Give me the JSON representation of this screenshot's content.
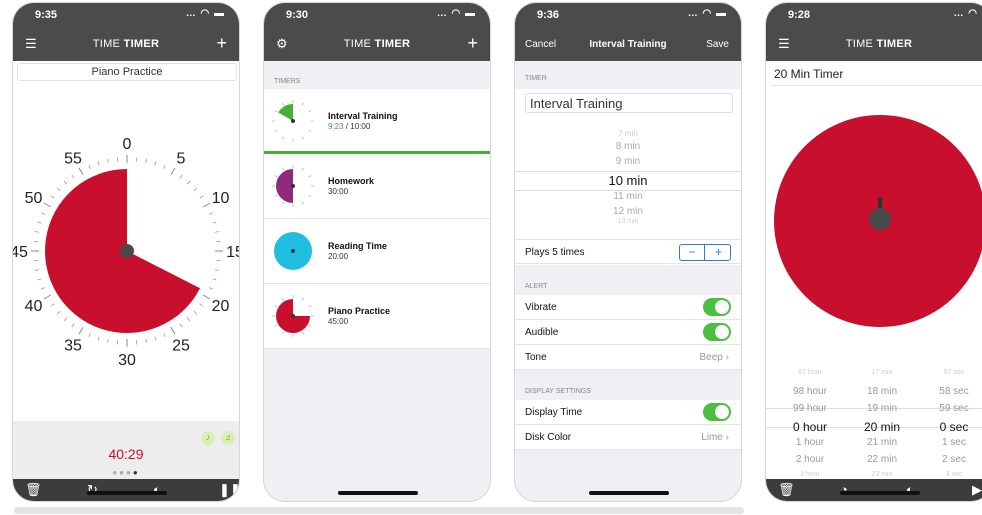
{
  "colors": {
    "red": "#c8102e",
    "lime": "#44b035",
    "purple": "#8e2a7a",
    "cyan": "#1fbede",
    "nav": "#4b4b4b"
  },
  "screen1": {
    "status_time": "9:35",
    "title_light": "TIME ",
    "title_bold": "TIMER",
    "menu_icon": "list-icon",
    "add_icon": "plus-icon",
    "timer_name": "Piano Practice",
    "dial_labels": [
      "0",
      "5",
      "10",
      "15",
      "20",
      "25",
      "30",
      "35",
      "40",
      "45",
      "50",
      "55"
    ],
    "remaining": "40:29",
    "remaining_minutes": 40.5,
    "page_dots": 4,
    "active_dot": 3,
    "toolbar": [
      "trash-icon",
      "reset-icon",
      "color-icon",
      "pause-icon"
    ]
  },
  "screen2": {
    "status_time": "9:30",
    "title_light": "TIME ",
    "title_bold": "TIMER",
    "section": "TIMERS",
    "timers": [
      {
        "name": "Interval Training",
        "elapsed": "9:23",
        "total": " / 10:00",
        "color": "#44b035",
        "minutes": 10
      },
      {
        "name": "Homework",
        "time": "30:00",
        "color": "#8e2a7a",
        "minutes": 30
      },
      {
        "name": "Reading Time",
        "time": "20:00",
        "color": "#1fbede",
        "minutes": 60
      },
      {
        "name": "Piano Practice",
        "time": "45:00",
        "color": "#c8102e",
        "minutes": 45
      }
    ]
  },
  "screen3": {
    "status_time": "9:36",
    "cancel": "Cancel",
    "title": "Interval Training",
    "save": "Save",
    "section_timer": "TIMER",
    "name_value": "Interval Training",
    "picker": [
      "7 min",
      "8 min",
      "9 min",
      "10 min",
      "11 min",
      "12 min",
      "13 min"
    ],
    "picker_selected": 3,
    "plays": "Plays 5 times",
    "stepper_minus": "−",
    "stepper_plus": "+",
    "section_alert": "ALERT",
    "vibrate": "Vibrate",
    "audible": "Audible",
    "tone": "Tone",
    "tone_value": "Beep",
    "section_display": "DISPLAY SETTINGS",
    "display_time": "Display Time",
    "disk_color": "Disk Color",
    "disk_color_value": "Lime"
  },
  "screen4": {
    "status_time": "9:28",
    "title_light": "TIME ",
    "title_bold": "TIMER",
    "timer_name": "20 Min Timer",
    "hours": [
      "97 hour",
      "98 hour",
      "99 hour",
      "0 hour",
      "1 hour",
      "2 hour",
      "3 hour"
    ],
    "mins": [
      "17 min",
      "18 min",
      "19 min",
      "20 min",
      "21 min",
      "22 min",
      "23 min"
    ],
    "secs": [
      "57 sec",
      "58 sec",
      "59 sec",
      "0 sec",
      "1 sec",
      "2 sec",
      "3 sec"
    ]
  }
}
